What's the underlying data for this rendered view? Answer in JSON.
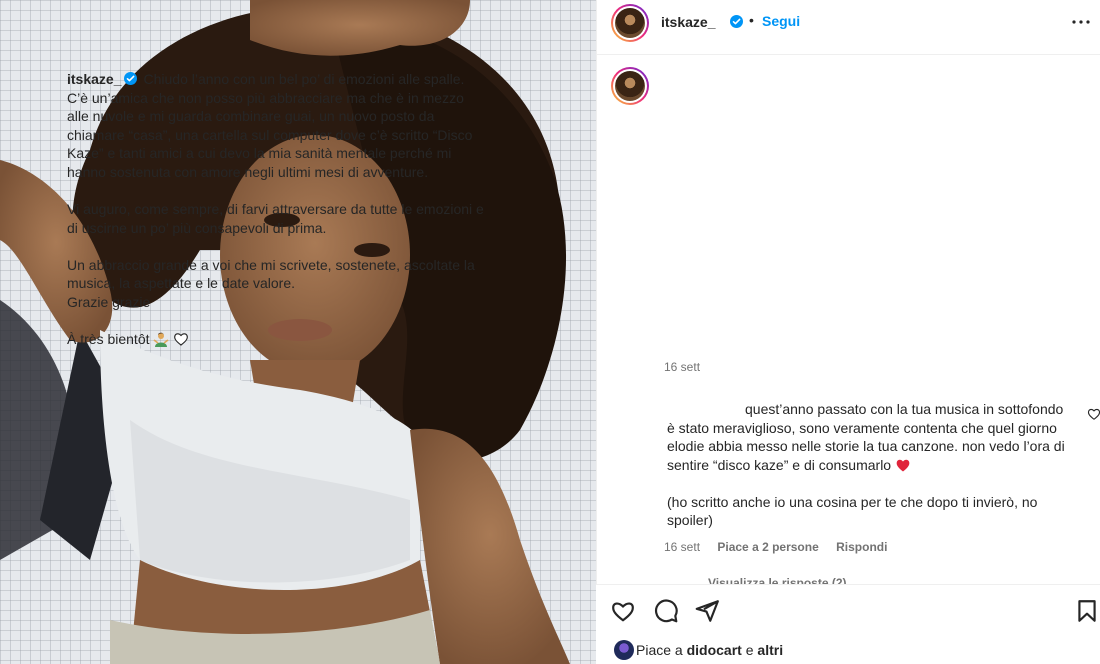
{
  "post": {
    "username": "itskaze_",
    "dot": "•",
    "follow_label": "Segui",
    "caption_username": "itskaze_",
    "caption_paragraphs": [
      "Chiudo l’anno con un bel po’ di emozioni alle spalle. C’è un’amica che non posso più abbracciare ma che è in mezzo alle nuvole e mi guarda combinare guai, un nuovo posto da chiamare “casa”, una cartella sul computer dove c’è scritto “Disco Kaze” e tanti amici a cui devo la mia sanità mentale perché mi hanno sostenuta con amore negli ultimi mesi di avventure.",
      "Vi auguro, come sempre, di farvi attraversare da tutte le emozioni e di uscirne un po’ più consapevoli di prima.",
      "Un abbraccio grande a voi che mi scrivete, sostenete, ascoltate la musica, la aspettate e le date valore.",
      "Grazie grazie",
      "À très bientôt"
    ],
    "caption_time": "16 sett"
  },
  "comment": {
    "paragraph1": "quest’anno passato con la tua musica in sottofondo è stato meraviglioso, sono veramente contenta che quel giorno elodie abbia messo nelle storie la tua canzone. non vedo l’ora di sentire “disco kaze” e di consumarlo",
    "paragraph2": "(ho scritto anche io una cosina per te che dopo ti invierò, no spoiler)",
    "time": "16 sett",
    "likes": "Piace a 2 persone",
    "reply": "Rispondi",
    "view_replies": "Visualizza le risposte (2)"
  },
  "actions": {
    "likes_prefix": "Piace a",
    "likes_user": "didocart",
    "likes_and": "e",
    "likes_others": "altri"
  },
  "icons": [
    "verified-icon",
    "more-options-icon",
    "heart-icon",
    "comment-icon",
    "share-icon",
    "save-icon",
    "red-heart-emoji",
    "person-gesture-emoji"
  ],
  "colors": {
    "accent": "#0095f6",
    "text": "#262626",
    "secondary": "#737373",
    "heart_red": "#ed4956"
  }
}
